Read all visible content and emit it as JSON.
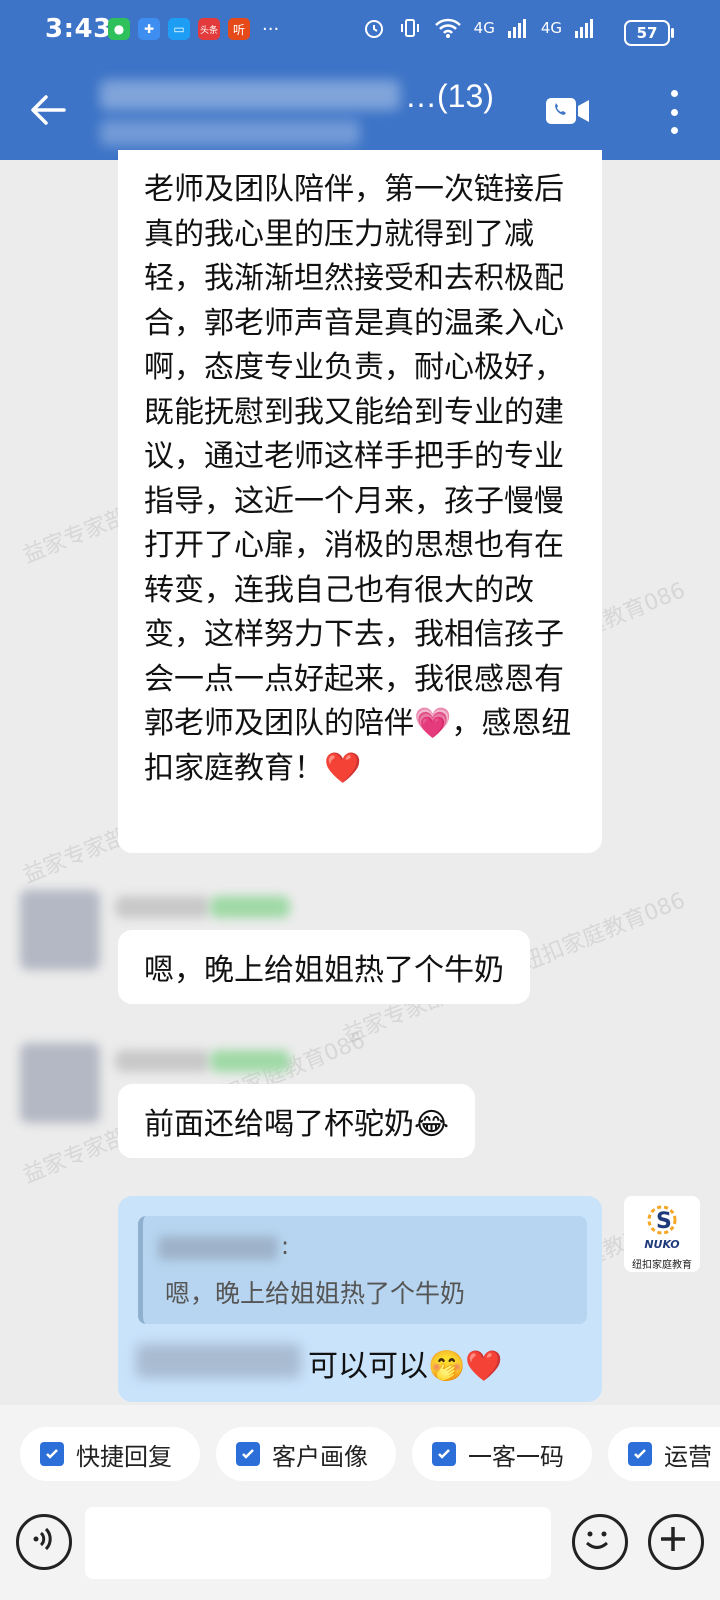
{
  "status_bar": {
    "time": "3:43",
    "more_indicator": "···",
    "network_1": "4G",
    "network_2": "4G",
    "battery": "57",
    "app_badge_1": "头条",
    "app_badge_2": "听"
  },
  "header": {
    "title_suffix": "…(13)",
    "icons": [
      "back-arrow-icon",
      "video-call-icon",
      "more-vertical-icon"
    ]
  },
  "messages": {
    "long_text": "老师及团队陪伴，第一次链接后真的我心里的压力就得到了减轻，我渐渐坦然接受和去积极配合，郭老师声音是真的温柔入心啊，态度专业负责，耐心极好，既能抚慰到我又能给到专业的建议，通过老师这样手把手的专业指导，这近一个月来，孩子慢慢打开了心扉，消极的思想也有在转变，连我自己也有很大的改变，这样努力下去，我相信孩子会一点一点好起来，我很感恩有郭老师及团队的陪伴💗，感恩纽扣家庭教育！❤️",
    "msg_2": "嗯，晚上给姐姐热了个牛奶",
    "msg_3": "前面还给喝了杯驼奶😂",
    "reply": {
      "quote_colon": ":",
      "quote_text": "嗯，晚上给姐姐热了个牛奶",
      "text": "可以可以🤭❤️"
    }
  },
  "logo": {
    "brand": "NUKO",
    "name": "纽扣家庭教育"
  },
  "watermark": "益家专家部-郭秀红(纽扣家庭教育086",
  "chips": [
    {
      "label": "快捷回复"
    },
    {
      "label": "客户画像"
    },
    {
      "label": "一客一码"
    },
    {
      "label": "运营"
    }
  ],
  "colors": {
    "header_bg": "#3d74c7",
    "chat_bg": "#ececec",
    "my_bubble": "#c9e3fb",
    "checkbox": "#2d6fd8"
  }
}
